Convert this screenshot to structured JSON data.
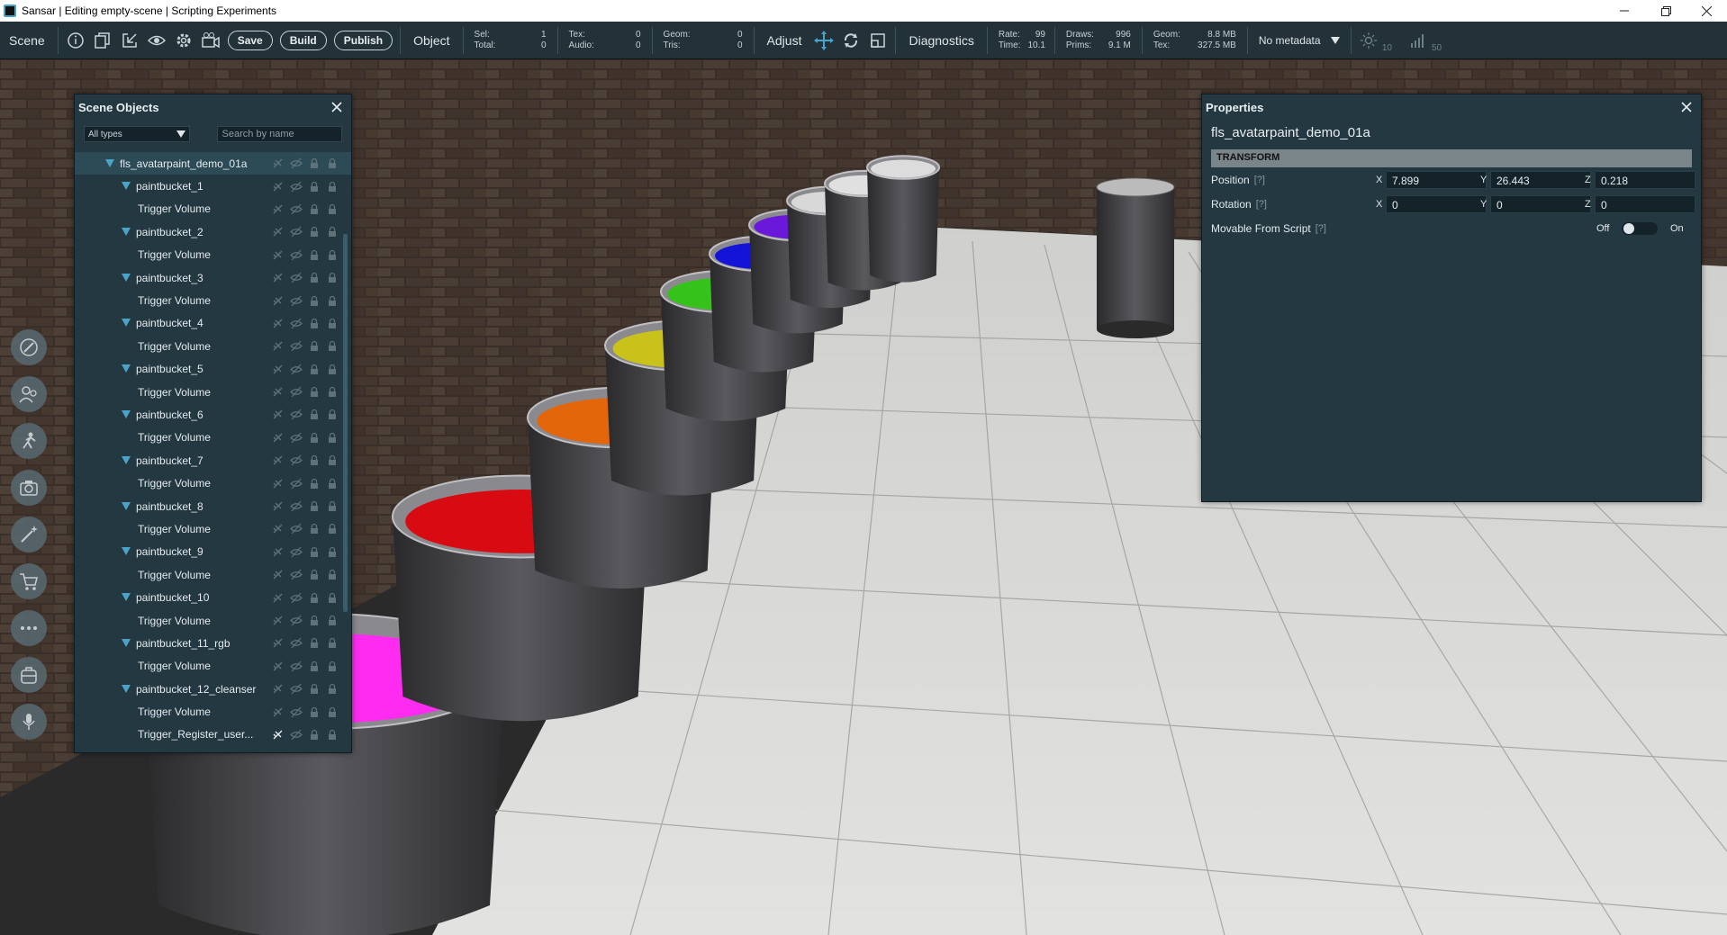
{
  "window": {
    "title": "Sansar | Editing empty-scene | Scripting Experiments"
  },
  "toolbar": {
    "scene_label": "Scene",
    "save_label": "Save",
    "build_label": "Build",
    "publish_label": "Publish",
    "object_label": "Object",
    "sel_label": "Sel:",
    "sel_value": "1",
    "total_label": "Total:",
    "total_value": "0",
    "tex_label": "Tex:",
    "tex_value": "0",
    "audio_label": "Audio:",
    "audio_value": "0",
    "geom_label": "Geom:",
    "geom_value": "0",
    "tris_label": "Tris:",
    "tris_value": "0",
    "adjust_label": "Adjust",
    "diagnostics_label": "Diagnostics",
    "rate_label": "Rate:",
    "rate_value": "99",
    "time_label": "Time:",
    "time_value": "10.1",
    "draws_label": "Draws:",
    "draws_value": "996",
    "prims_label": "Prims:",
    "prims_value": "9.1 M",
    "dgeom_label": "Geom:",
    "dgeom_value": "8.8 MB",
    "dtex_label": "Tex:",
    "dtex_value": "327.5 MB",
    "metadata_select": "No metadata",
    "light_value": "10",
    "signal_value": "50"
  },
  "scene_objects": {
    "title": "Scene Objects",
    "filter_value": "All types",
    "search_placeholder": "Search by name",
    "items": [
      {
        "label": "fls_avatarpaint_demo_01a",
        "depth": 0,
        "expandable": true,
        "selected": true
      },
      {
        "label": "paintbucket_1",
        "depth": 1,
        "expandable": true
      },
      {
        "label": "Trigger Volume",
        "depth": 2,
        "expandable": false
      },
      {
        "label": "paintbucket_2",
        "depth": 1,
        "expandable": true
      },
      {
        "label": "Trigger Volume",
        "depth": 2,
        "expandable": false
      },
      {
        "label": "paintbucket_3",
        "depth": 1,
        "expandable": true
      },
      {
        "label": "Trigger Volume",
        "depth": 2,
        "expandable": false
      },
      {
        "label": "paintbucket_4",
        "depth": 1,
        "expandable": true
      },
      {
        "label": "Trigger Volume",
        "depth": 2,
        "expandable": false
      },
      {
        "label": "paintbucket_5",
        "depth": 1,
        "expandable": true
      },
      {
        "label": "Trigger Volume",
        "depth": 2,
        "expandable": false
      },
      {
        "label": "paintbucket_6",
        "depth": 1,
        "expandable": true
      },
      {
        "label": "Trigger Volume",
        "depth": 2,
        "expandable": false
      },
      {
        "label": "paintbucket_7",
        "depth": 1,
        "expandable": true
      },
      {
        "label": "Trigger Volume",
        "depth": 2,
        "expandable": false
      },
      {
        "label": "paintbucket_8",
        "depth": 1,
        "expandable": true
      },
      {
        "label": "Trigger Volume",
        "depth": 2,
        "expandable": false
      },
      {
        "label": "paintbucket_9",
        "depth": 1,
        "expandable": true
      },
      {
        "label": "Trigger Volume",
        "depth": 2,
        "expandable": false
      },
      {
        "label": "paintbucket_10",
        "depth": 1,
        "expandable": true
      },
      {
        "label": "Trigger Volume",
        "depth": 2,
        "expandable": false
      },
      {
        "label": "paintbucket_11_rgb",
        "depth": 1,
        "expandable": true
      },
      {
        "label": "Trigger Volume",
        "depth": 2,
        "expandable": false
      },
      {
        "label": "paintbucket_12_cleanser",
        "depth": 1,
        "expandable": true
      },
      {
        "label": "Trigger Volume",
        "depth": 2,
        "expandable": false
      },
      {
        "label": "Trigger_Register_user...",
        "depth": 2,
        "expandable": false,
        "highlight_icon": true
      }
    ]
  },
  "properties": {
    "title": "Properties",
    "object_name": "fls_avatarpaint_demo_01a",
    "section_transform": "TRANSFORM",
    "help": "[?]",
    "position_label": "Position",
    "rotation_label": "Rotation",
    "movable_label": "Movable From Script",
    "axis_x": "X",
    "axis_y": "Y",
    "axis_z": "Z",
    "position": {
      "x": "7.899",
      "y": "26.443",
      "z": "0.218"
    },
    "rotation": {
      "x": "0",
      "y": "0",
      "z": "0"
    },
    "toggle_off": "Off",
    "toggle_on": "On",
    "movable_state": "off"
  },
  "paint_colors": [
    "#ff2bf0",
    "#d90b12",
    "#e3660b",
    "#c8c21a",
    "#35c21a",
    "#1414d9",
    "#6a18d9",
    "#d8d8d8",
    "#e0e0e0",
    "#dcdcdc"
  ]
}
